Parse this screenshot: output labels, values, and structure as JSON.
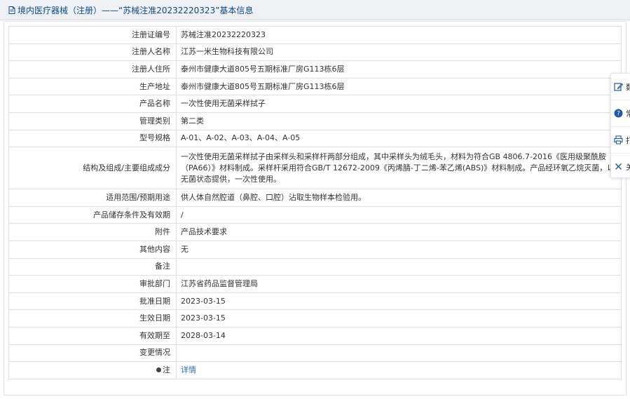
{
  "header": {
    "title": "境内医疗器械（注册）——“苏械注准20232220323”基本信息"
  },
  "rows": [
    {
      "label": "注册证编号",
      "value": "苏械注准20232220323"
    },
    {
      "label": "注册人名称",
      "value": "江苏一米生物科技有限公司"
    },
    {
      "label": "注册人住所",
      "value": "泰州市健康大道805号五期标准厂房G113栋6层"
    },
    {
      "label": "生产地址",
      "value": "泰州市健康大道805号五期标准厂房G113栋6层"
    },
    {
      "label": "产品名称",
      "value": "一次性使用无菌采样拭子"
    },
    {
      "label": "管理类别",
      "value": "第二类"
    },
    {
      "label": "型号规格",
      "value": "A-01、A-02、A-03、A-04、A-05"
    },
    {
      "label": "结构及组成/主要组成成分",
      "value": "一次性使用无菌采样拭子由采样头和采样杆两部分组成，其中采样头为绒毛头，材料为符合GB 4806.7-2016《医用级聚酰胺（PA66）》材料制成。采样杆采用符合GB/T 12672-2009《丙烯腈-丁二烯-苯乙烯(ABS)》材料制成。产品经环氧乙烷灭菌，以无菌状态提供，一次性使用。"
    },
    {
      "label": "适用范围/预期用途",
      "value": "供人体自然腔道（鼻腔、口腔）沾取生物样本检验用。"
    },
    {
      "label": "产品储存条件及有效期",
      "value": "/"
    },
    {
      "label": "附件",
      "value": "产品技术要求"
    },
    {
      "label": "其他内容",
      "value": "无"
    },
    {
      "label": "备注",
      "value": ""
    },
    {
      "label": "审批部门",
      "value": "江苏省药品监督管理局"
    },
    {
      "label": "批准日期",
      "value": "2023-03-15"
    },
    {
      "label": "生效日期",
      "value": "2023-03-15"
    },
    {
      "label": "有效期至",
      "value": "2028-03-14"
    },
    {
      "label": "变更情况",
      "value": ""
    },
    {
      "label": "注",
      "value": "详情"
    }
  ],
  "sidebar": {
    "items": [
      {
        "label": "数",
        "icon": "edit-icon"
      },
      {
        "label": "常",
        "icon": "help-icon"
      },
      {
        "label": "打",
        "icon": "print-icon"
      },
      {
        "label": "关",
        "icon": "close-icon"
      }
    ]
  },
  "colors": {
    "header_bg": "#eef0f3",
    "header_text": "#0c4a8c",
    "link": "#2a6cc4",
    "border": "#dcdfe4"
  }
}
